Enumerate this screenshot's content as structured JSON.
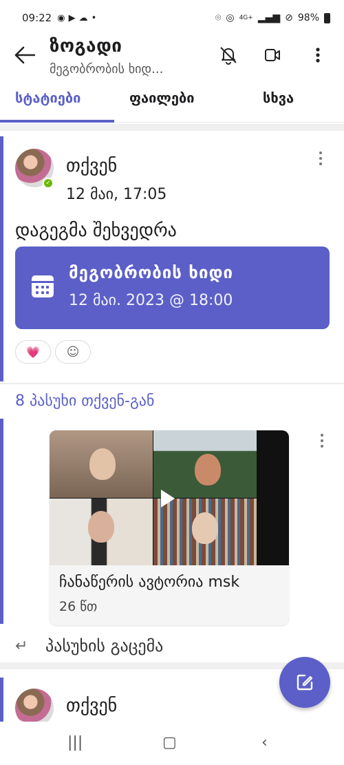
{
  "status_bar": {
    "time": "09:22",
    "battery": "98%",
    "network": "4G+"
  },
  "header": {
    "title": "ზოგადი",
    "subtitle": "მეგობრობის ხიდ..."
  },
  "tabs": [
    {
      "label": "სტატიები",
      "active": true
    },
    {
      "label": "ფაილები",
      "active": false
    },
    {
      "label": "სხვა",
      "active": false
    }
  ],
  "post": {
    "author": "თქვენ",
    "timestamp": "12 მაი, 17:05",
    "text": "დაგეგმა შეხვედრა",
    "event": {
      "title": "მეგობრობის ხიდი",
      "date": "12 მაი. 2023 @ 18:00"
    },
    "reactions": [
      {
        "icon": "heart-icon",
        "glyph": "💗"
      },
      {
        "icon": "add-reaction-icon",
        "glyph": "☺"
      }
    ],
    "replies_link": "8 პასუხი თქვენ-გან"
  },
  "reply": {
    "video": {
      "title": "ჩანაწერის ავტორია msk",
      "duration": "26 წთ"
    },
    "action_label": "პასუხის გაცემა"
  },
  "next_post": {
    "author": "თქვენ"
  },
  "colors": {
    "accent": "#5b5fc7",
    "presence": "#6bb700"
  }
}
